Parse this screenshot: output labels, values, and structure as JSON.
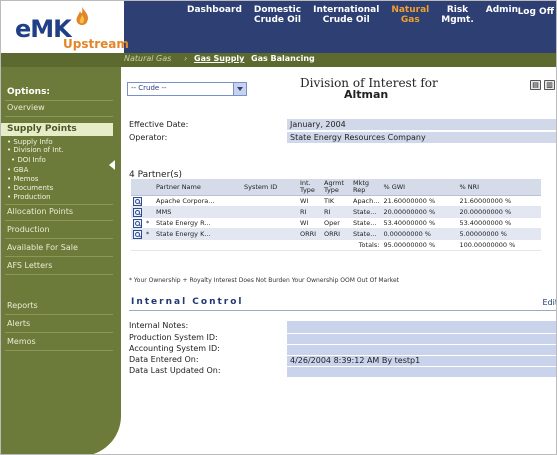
{
  "header": {
    "logo_main": "eMK",
    "logo_sub": "Upstream",
    "nav": [
      {
        "line1": "Dashboard",
        "line2": "",
        "active": false
      },
      {
        "line1": "Domestic",
        "line2": "Crude Oil",
        "active": false
      },
      {
        "line1": "International",
        "line2": "Crude Oil",
        "active": false
      },
      {
        "line1": "Natural",
        "line2": "Gas",
        "active": true
      },
      {
        "line1": "Risk",
        "line2": "Mgmt.",
        "active": false
      },
      {
        "line1": "Admin",
        "line2": "",
        "active": false
      }
    ],
    "logoff": "Log Off"
  },
  "subnav": {
    "section": "Natural Gas",
    "items": [
      "Gas Supply",
      "Gas Balancing"
    ]
  },
  "sidebar": {
    "title": "Options:",
    "items": [
      "Overview",
      "Supply Points",
      "• Supply Info",
      "• Division of Int.",
      "• DOI Info",
      "• GBA",
      "• Memos",
      "• Documents",
      "• Production",
      "Allocation Points",
      "Production",
      "Available For Sale",
      "AFS Letters",
      "Reports",
      "Alerts",
      "Memos"
    ]
  },
  "main": {
    "crude_select": "-- Crude --",
    "title_line1": "Division of Interest for",
    "title_line2": "Altman",
    "effective_date_label": "Effective Date:",
    "effective_date": "January, 2004",
    "operator_label": "Operator:",
    "operator": "State Energy Resources Company",
    "partners_label": "4 Partner(s)",
    "columns": [
      "",
      "",
      "Partner Name",
      "System ID",
      "Int. Type",
      "Agrmt Type",
      "Mktg Rep",
      "% GWI",
      "% NRI"
    ],
    "rows": [
      {
        "mark": "",
        "name": "Apache Corpora...",
        "sysid": "",
        "int": "WI",
        "agrmt": "TIK",
        "mktg": "Apach...",
        "gwi": "21.60000000 %",
        "nri": "21.60000000 %"
      },
      {
        "mark": "",
        "name": "MMS",
        "sysid": "",
        "int": "RI",
        "agrmt": "RI",
        "mktg": "State...",
        "gwi": "20.00000000 %",
        "nri": "20.00000000 %"
      },
      {
        "mark": "*",
        "name": "State Energy R...",
        "sysid": "",
        "int": "WI",
        "agrmt": "Oper",
        "mktg": "State...",
        "gwi": "53.40000000 %",
        "nri": "53.40000000 %"
      },
      {
        "mark": "*",
        "name": "State Energy K...",
        "sysid": "",
        "int": "ORRI",
        "agrmt": "ORRI",
        "mktg": "State...",
        "gwi": "0.00000000 %",
        "nri": "5.00000000 %"
      }
    ],
    "totals_label": "Totals:",
    "total_gwi": "95.00000000 %",
    "total_nri": "100.00000000 %",
    "legend": "* Your Ownership  + Royalty Interest Does Not Burden Your Ownership OOM Out Of Market",
    "ic_title": "Internal Control",
    "ic_edit": "Edit",
    "ic_fields": [
      {
        "label": "Internal Notes:",
        "value": ""
      },
      {
        "label": "Production System ID:",
        "value": ""
      },
      {
        "label": "Accounting System ID:",
        "value": ""
      },
      {
        "label": "Data Entered On:",
        "value": "4/26/2004 8:39:12 AM  By testp1"
      },
      {
        "label": "Data Last Updated On:",
        "value": ""
      }
    ]
  },
  "colors": {
    "header_bg": "#2e3f73",
    "sidebar_bg": "#6d7b3a",
    "accent_orange": "#e2862a",
    "field_bg": "#d0d8ea"
  }
}
